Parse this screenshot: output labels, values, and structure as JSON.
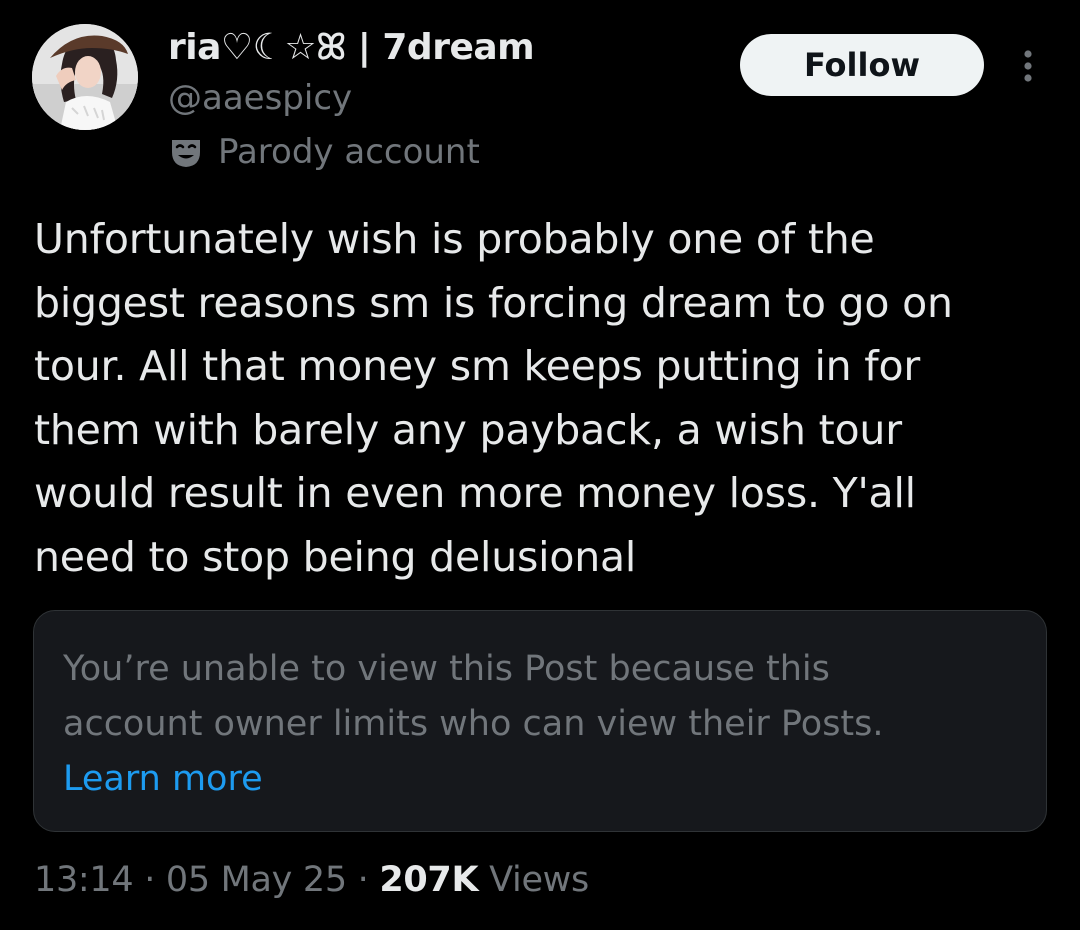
{
  "author": {
    "display_name": "ria♡☾☆ꕤ | 7dream",
    "handle": "@aaespicy",
    "label_text": "Parody account",
    "label_icon": "parody-mask-icon",
    "avatar_icon": "avatar-photo"
  },
  "actions": {
    "follow_label": "Follow",
    "more_icon": "more-options-icon"
  },
  "post": {
    "text_lines": [
      "Unfortunately wish is probably one of the",
      "biggest reasons sm is forcing dream to go on",
      "tour. All that money sm keeps putting in for",
      "them with barely any payback, a wish tour",
      "would result in even more money loss. Y'all",
      "need to stop being delusional"
    ]
  },
  "quoted_notice": {
    "lines": [
      "You’re unable to view this Post because this",
      "account owner limits who can view their Posts."
    ],
    "link_label": "Learn more"
  },
  "meta": {
    "time": "13:14",
    "separator": "·",
    "date": "05 May 25",
    "views_count": "207K",
    "views_label": "Views"
  },
  "colors": {
    "background": "#000000",
    "primary_text": "#e7e9ea",
    "secondary_text": "#71767b",
    "link": "#1d9bf0",
    "follow_button_bg": "#eff3f4",
    "notice_bg": "#16181c",
    "notice_border": "#2f3336"
  }
}
